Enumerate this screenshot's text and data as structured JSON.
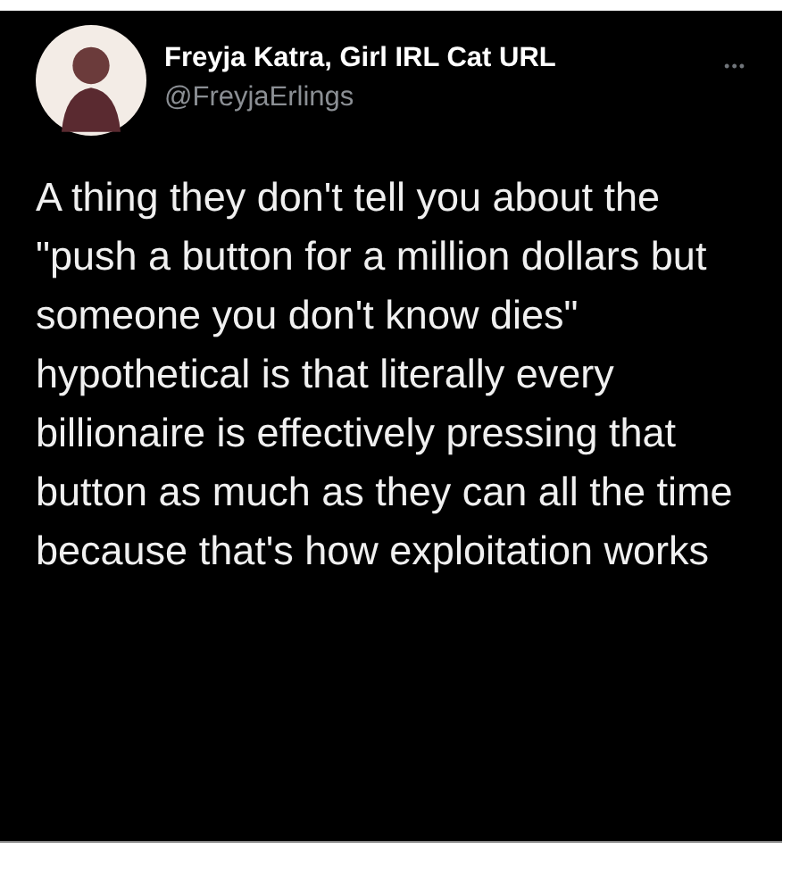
{
  "tweet": {
    "display_name": "Freyja Katra, Girl IRL Cat URL",
    "handle": "@FreyjaErlings",
    "menu": "•••",
    "text": "A thing they don't tell you about the \"push a button for a million dollars but someone you don't know dies\" hypothetical is that literally every billionaire is effectively pressing that button as much as they can all the time because that's how exploitation works"
  }
}
